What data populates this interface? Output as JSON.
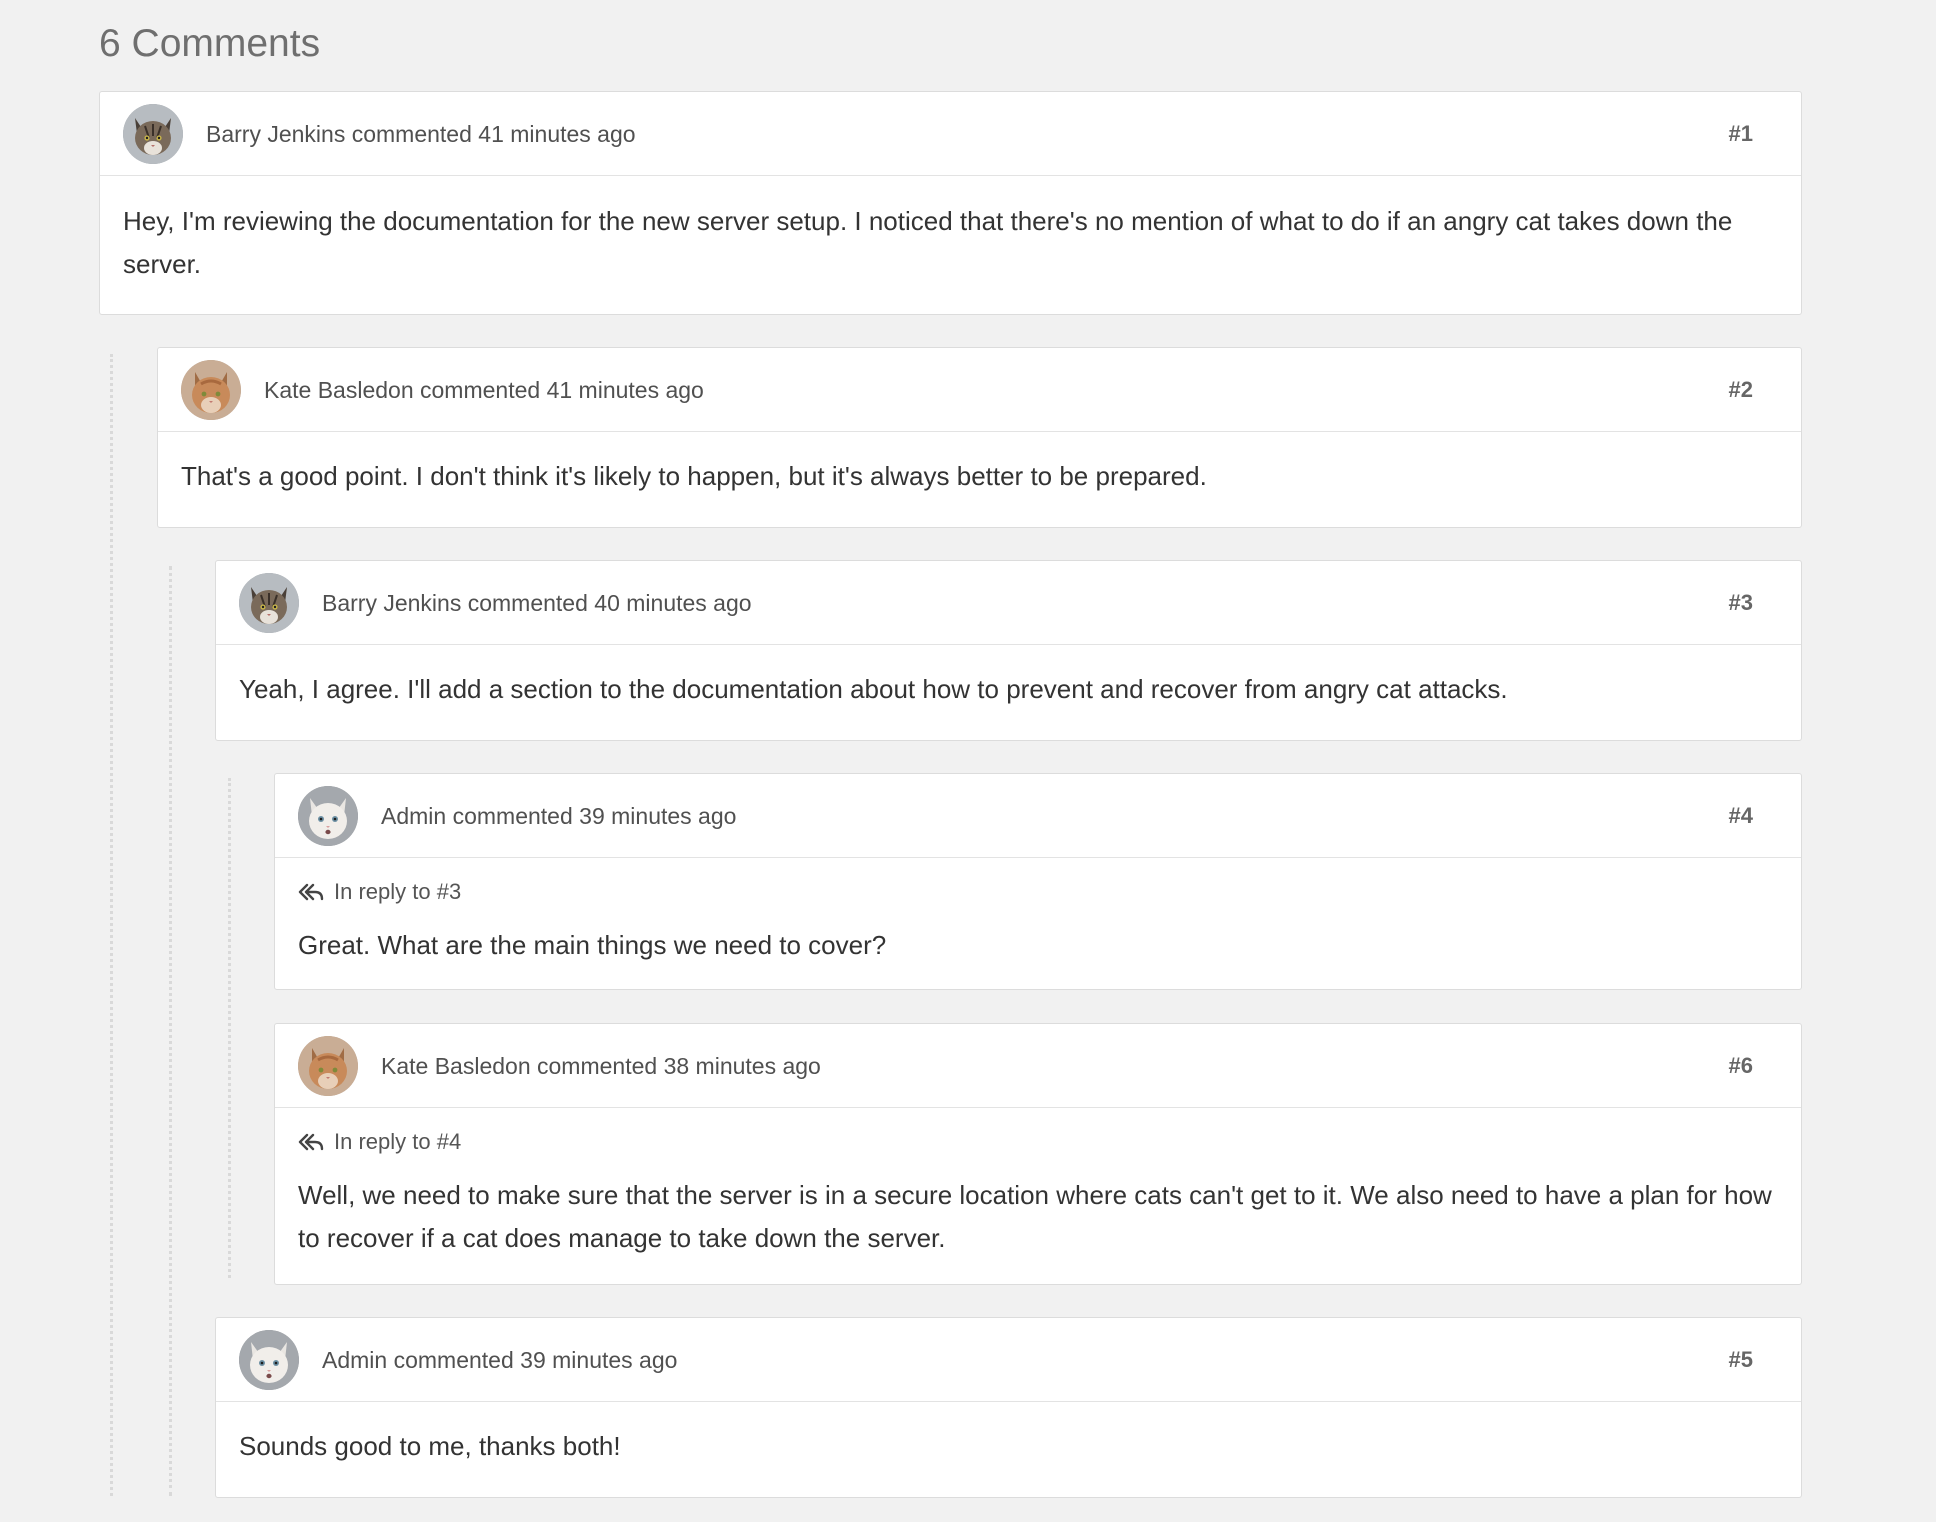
{
  "heading": "6 Comments",
  "comments": [
    {
      "author": "Barry Jenkins",
      "verb": "commented",
      "time": "41 minutes ago",
      "number": "#1",
      "avatar": "tabby-cat-avatar",
      "reply_to": "",
      "text": "Hey, I'm reviewing the documentation for the new server setup. I noticed that there's no mention of what to do if an angry cat takes down the server."
    },
    {
      "author": "Kate Basledon",
      "verb": "commented",
      "time": "41 minutes ago",
      "number": "#2",
      "avatar": "ginger-cat-avatar",
      "reply_to": "",
      "text": "That's a good point. I don't think it's likely to happen, but it's always better to be prepared."
    },
    {
      "author": "Barry Jenkins",
      "verb": "commented",
      "time": "40 minutes ago",
      "number": "#3",
      "avatar": "tabby-cat-avatar",
      "reply_to": "",
      "text": "Yeah, I agree. I'll add a section to the documentation about how to prevent and recover from angry cat attacks."
    },
    {
      "author": "Admin",
      "verb": "commented",
      "time": "39 minutes ago",
      "number": "#4",
      "avatar": "white-cat-avatar",
      "reply_to": "In reply to #3",
      "text": "Great. What are the main things we need to cover?"
    },
    {
      "author": "Kate Basledon",
      "verb": "commented",
      "time": "38 minutes ago",
      "number": "#6",
      "avatar": "ginger-cat-avatar",
      "reply_to": "In reply to #4",
      "text": "Well, we need to make sure that the server is in a secure location where cats can't get to it. We also need to have a plan for how to recover if a cat does manage to take down the server."
    },
    {
      "author": "Admin",
      "verb": "commented",
      "time": "39 minutes ago",
      "number": "#5",
      "avatar": "white-cat-avatar",
      "reply_to": "",
      "text": "Sounds good to me, thanks both!"
    }
  ],
  "icons": {
    "reply": "reply-all-icon"
  },
  "colors": {
    "background": "#f1f1f1",
    "card": "#ffffff",
    "border": "#dcdcdc",
    "thread_line": "#d9d9d9"
  }
}
